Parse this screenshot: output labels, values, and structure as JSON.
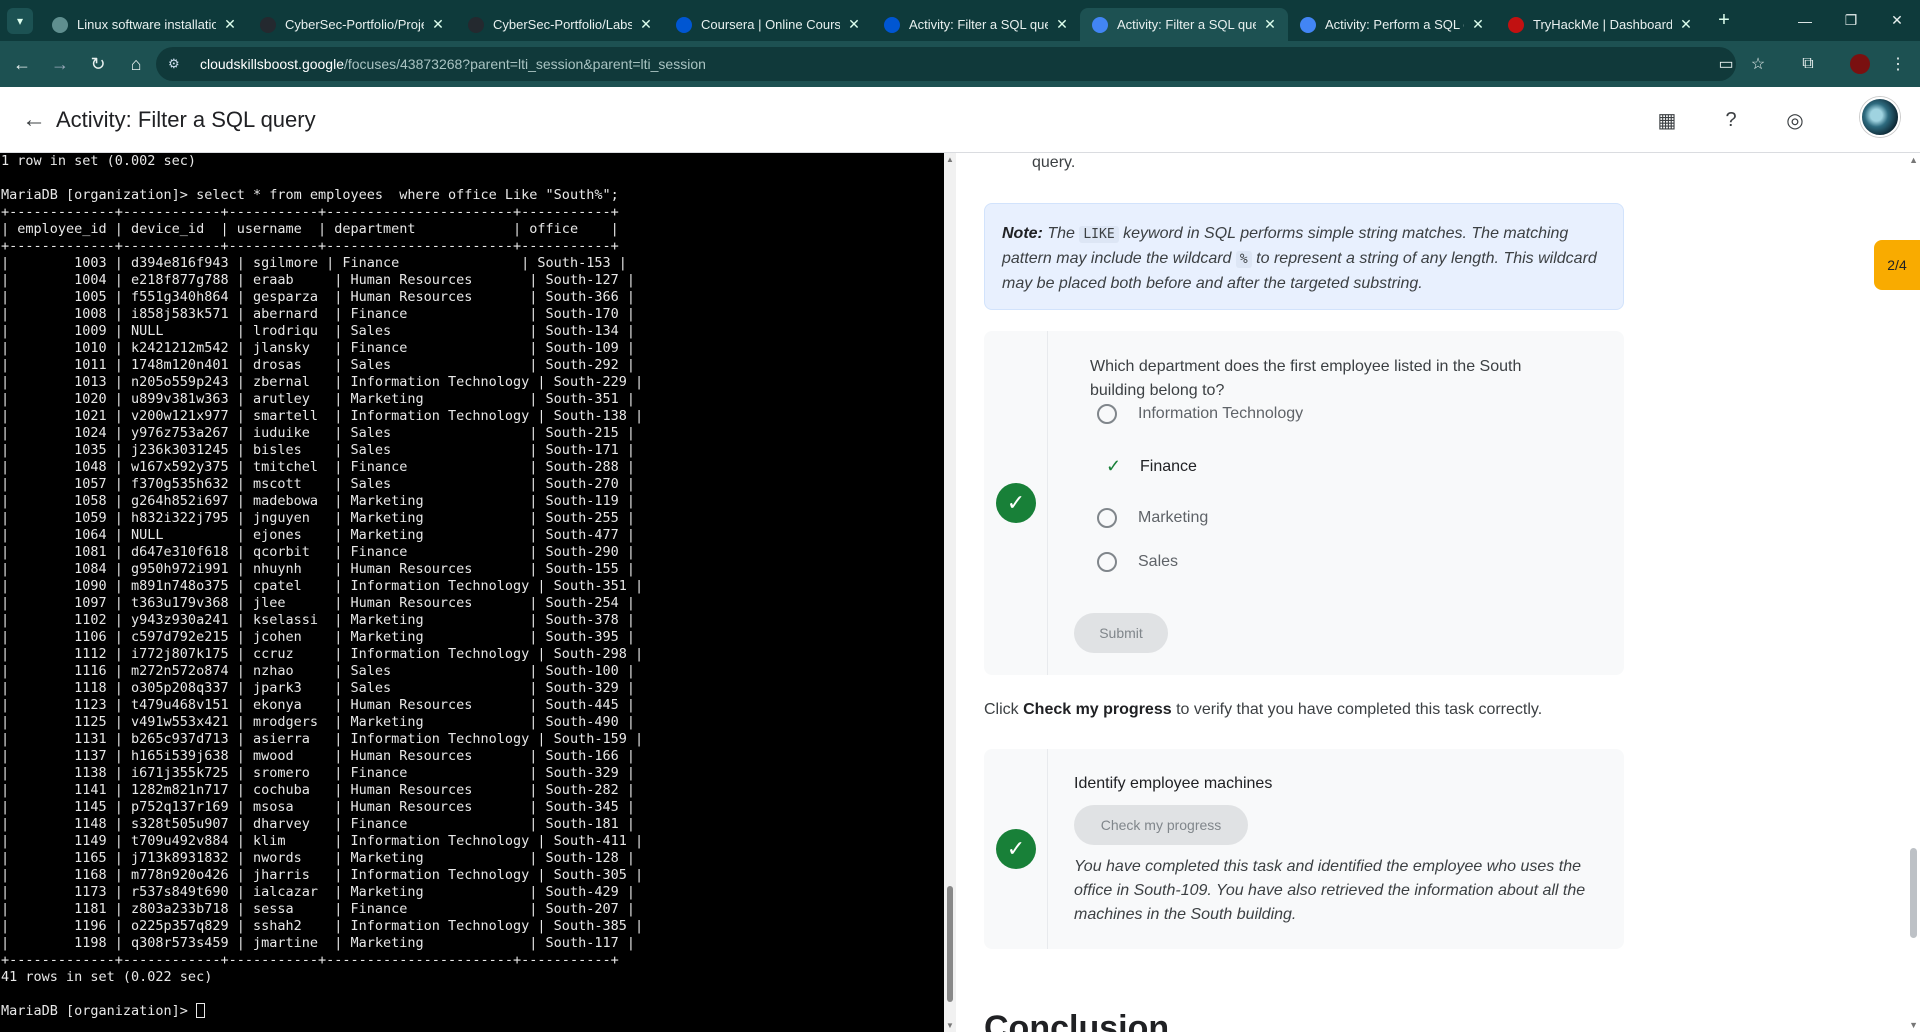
{
  "browser": {
    "tabs": [
      {
        "title": "Linux software installation",
        "favicon": "chrome-icon",
        "color": "#5f8f8f"
      },
      {
        "title": "CyberSec-Portfolio/Projec",
        "favicon": "github-icon",
        "color": "#24292f"
      },
      {
        "title": "CyberSec-Portfolio/Labs/(",
        "favicon": "github-icon",
        "color": "#24292f"
      },
      {
        "title": "Coursera | Online Courses",
        "favicon": "coursera-icon",
        "color": "#0056d2"
      },
      {
        "title": "Activity: Filter a SQL query",
        "favicon": "coursera-icon",
        "color": "#0056d2"
      },
      {
        "title": "Activity: Filter a SQL query",
        "favicon": "google-cloud-icon",
        "color": "#4285f4",
        "active": true
      },
      {
        "title": "Activity: Perform a SQL qu",
        "favicon": "google-cloud-icon",
        "color": "#4285f4"
      },
      {
        "title": "TryHackMe | Dashboard",
        "favicon": "tryhackme-icon",
        "color": "#c11111"
      }
    ],
    "url_host": "cloudskillsboost.google",
    "url_path": "/focuses/43873268?parent=lti_session&parent=lti_session"
  },
  "header": {
    "title": "Activity: Filter a SQL query"
  },
  "terminal": {
    "lines": [
      "1 row in set (0.002 sec)",
      "",
      "MariaDB [organization]> select * from employees  where office Like \"South%\";",
      "+-------------+------------+-----------+-----------------------+-----------+",
      "| employee_id | device_id  | username  | department            | office    |",
      "+-------------+------------+-----------+-----------------------+-----------+",
      "|        1003 | d394e816f943 | sgilmore | Finance               | South-153 |",
      "|        1004 | e218f877g788 | eraab     | Human Resources       | South-127 |",
      "|        1005 | f551g340h864 | gesparza  | Human Resources       | South-366 |",
      "|        1008 | i858j583k571 | abernard  | Finance               | South-170 |",
      "|        1009 | NULL         | lrodriqu  | Sales                 | South-134 |",
      "|        1010 | k2421212m542 | jlansky   | Finance               | South-109 |",
      "|        1011 | 1748m120n401 | drosas    | Sales                 | South-292 |",
      "|        1013 | n205o559p243 | zbernal   | Information Technology | South-229 |",
      "|        1020 | u899v381w363 | arutley   | Marketing             | South-351 |",
      "|        1021 | v200w121x977 | smartell  | Information Technology | South-138 |",
      "|        1024 | y976z753a267 | iuduike   | Sales                 | South-215 |",
      "|        1035 | j236k3031245 | bisles    | Sales                 | South-171 |",
      "|        1048 | w167x592y375 | tmitchel  | Finance               | South-288 |",
      "|        1057 | f370g535h632 | mscott    | Sales                 | South-270 |",
      "|        1058 | g264h852i697 | madebowa  | Marketing             | South-119 |",
      "|        1059 | h832i322j795 | jnguyen   | Marketing             | South-255 |",
      "|        1064 | NULL         | ejones    | Marketing             | South-477 |",
      "|        1081 | d647e310f618 | qcorbit   | Finance               | South-290 |",
      "|        1084 | g950h972i991 | nhuynh    | Human Resources       | South-155 |",
      "|        1090 | m891n748o375 | cpatel    | Information Technology | South-351 |",
      "|        1097 | t363u179v368 | jlee      | Human Resources       | South-254 |",
      "|        1102 | y943z930a241 | kselassi  | Marketing             | South-378 |",
      "|        1106 | c597d792e215 | jcohen    | Marketing             | South-395 |",
      "|        1112 | i772j807k175 | ccruz     | Information Technology | South-298 |",
      "|        1116 | m272n572o874 | nzhao     | Sales                 | South-100 |",
      "|        1118 | o305p208q337 | jpark3    | Sales                 | South-329 |",
      "|        1123 | t479u468v151 | ekonya    | Human Resources       | South-445 |",
      "|        1125 | v491w553x421 | mrodgers  | Marketing             | South-490 |",
      "|        1131 | b265c937d713 | asierra   | Information Technology | South-159 |",
      "|        1137 | h165i539j638 | mwood     | Human Resources       | South-166 |",
      "|        1138 | i671j355k725 | sromero   | Finance               | South-329 |",
      "|        1141 | 1282m821n717 | cochuba   | Human Resources       | South-282 |",
      "|        1145 | p752q137r169 | msosa     | Human Resources       | South-345 |",
      "|        1148 | s328t505u907 | dharvey   | Finance               | South-181 |",
      "|        1149 | t709u492v884 | klim      | Information Technology | South-411 |",
      "|        1165 | j713k8931832 | nwords    | Marketing             | South-128 |",
      "|        1168 | m778n920o426 | jharris   | Information Technology | South-305 |",
      "|        1173 | r537s849t690 | ialcazar  | Marketing             | South-429 |",
      "|        1181 | z803a233b718 | sessa     | Finance               | South-207 |",
      "|        1196 | o225p357q829 | sshah2    | Information Technology | South-385 |",
      "|        1198 | q308r573s459 | jmartine  | Marketing             | South-117 |",
      "+-------------+------------+-----------+-----------------------+-----------+",
      "41 rows in set (0.022 sec)",
      ""
    ],
    "prompt": "MariaDB [organization]> "
  },
  "content": {
    "frag_query": "query.",
    "note_label": "Note:",
    "note_text_1": " The ",
    "note_code_1": "LIKE",
    "note_text_2": " keyword in SQL performs simple string matches. The matching pattern may include the wildcard ",
    "note_code_2": "%",
    "note_text_3": " to represent a string of any length. This wildcard may be placed both before and after the targeted substring.",
    "question": "Which department does the first employee listed in the South building belong to?",
    "options": [
      "Information Technology",
      "Finance",
      "Marketing",
      "Sales"
    ],
    "correct_option": "Finance",
    "submit_label": "Submit",
    "progress_prefix": "Click ",
    "progress_bold": "Check my progress",
    "progress_suffix": " to verify that you have completed this task correctly.",
    "task_title": "Identify employee machines",
    "check_progress_label": "Check my progress",
    "task_done": "You have completed this task and identified the employee who uses the office in South-109. You have also retrieved the information about all the machines in the South building.",
    "conclusion": "Conclusion",
    "step_pill": "2/4"
  },
  "colors": {
    "chrome_bg": "#0e3a3b",
    "success_green": "#188038",
    "note_bg": "#e8f0fe",
    "step_pill": "#f9ab00"
  }
}
